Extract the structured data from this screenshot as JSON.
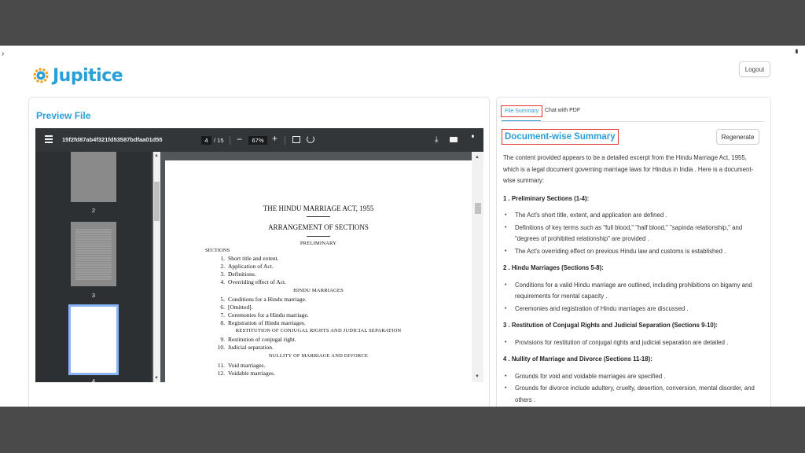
{
  "header": {
    "logo_text": "Jupitice",
    "logout_label": "Logout"
  },
  "preview": {
    "title": "Preview File",
    "viewer": {
      "filename": "15f2fd87ab4f321fd53587bdfaa01d55",
      "current_page": "4",
      "total_pages": "/ 15",
      "zoom": "67%",
      "thumbnails": [
        "2",
        "3",
        "4"
      ]
    },
    "document": {
      "title": "THE HINDU MARRIAGE ACT, 1955",
      "subtitle": "ARRANGEMENT OF SECTIONS",
      "headings": {
        "preliminary": "PRELIMINARY",
        "sections": "SECTIONS",
        "hindu_marriages": "HINDU MARRIAGES",
        "restitution": "RESTITUTION OF CONJUGAL RIGHTS AND JUDICIAL SEPARATION",
        "nullity": "NULLITY OF MARRIAGE AND DIVORCE"
      },
      "toc": [
        {
          "n": "1.",
          "text": "Short title and extent."
        },
        {
          "n": "2.",
          "text": "Application of Act."
        },
        {
          "n": "3.",
          "text": "Definitions."
        },
        {
          "n": "4.",
          "text": "Overriding effect of Act."
        },
        {
          "n": "5.",
          "text": "Conditions for a Hindu marriage."
        },
        {
          "n": "6.",
          "text": "[Omitted]."
        },
        {
          "n": "7.",
          "text": "Ceremonies for a Hindu marriage."
        },
        {
          "n": "8.",
          "text": "Registration of Hindu marriages."
        },
        {
          "n": "9.",
          "text": "Restitution of conjugal right."
        },
        {
          "n": "10.",
          "text": "Judicial separation."
        },
        {
          "n": "11.",
          "text": "Void marriages."
        },
        {
          "n": "12.",
          "text": "Voidable marriages."
        }
      ]
    }
  },
  "summary": {
    "tabs": {
      "file_summary": "File Summary",
      "chat": "Chat with PDF"
    },
    "title": "Document-wise Summary",
    "regenerate_label": "Regenerate",
    "intro": "The content provided appears to be a detailed excerpt from the Hindu Marriage Act, 1955, which is a legal document governing marriage laws for Hindus in India . Here is a document-wise summary:",
    "sections": [
      {
        "num": "1 .",
        "heading": "Preliminary Sections (1-4):",
        "bullets": [
          "The Act's short title, extent, and application are defined .",
          "Definitions of key terms such as \"full blood,\" \"half blood,\" \"sapinda relationship,\" and \"degrees of prohibited relationship\" are provided .",
          "The Act's overriding effect on previous Hindu law and customs is established ."
        ]
      },
      {
        "num": "2 .",
        "heading": "Hindu Marriages (Sections 5-8):",
        "bullets": [
          "Conditions for a valid Hindu marriage are outlined, including prohibitions on bigamy and requirements for mental capacity .",
          "Ceremonies and registration of Hindu marriages are discussed ."
        ]
      },
      {
        "num": "3 .",
        "heading": "Restitution of Conjugal Rights and Judicial Separation (Sections 9-10):",
        "bullets": [
          "Provisions for restitution of conjugal rights and judicial separation are detailed ."
        ]
      },
      {
        "num": "4 .",
        "heading": "Nullity of Marriage and Divorce (Sections 11-18):",
        "bullets": [
          "Grounds for void and voidable marriages are specified .",
          "Grounds for divorce include adultery, cruelty, desertion, conversion, mental disorder, and others ."
        ]
      }
    ]
  },
  "colors": {
    "accent": "#2a9fd6",
    "highlight_border": "#e53935",
    "viewer_toolbar": "#323639",
    "viewer_bg": "#525659"
  }
}
